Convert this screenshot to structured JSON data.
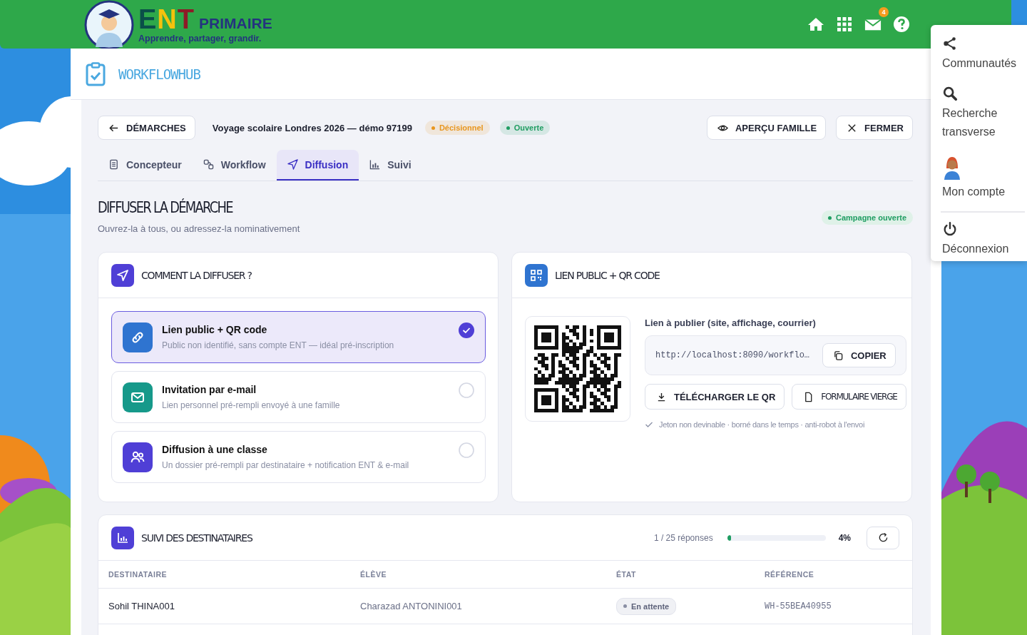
{
  "header": {
    "logo": {
      "letters": "ENT",
      "word": "PRIMAIRE",
      "tagline": "Apprendre, partager, grandir."
    },
    "mail_badge": "4"
  },
  "user_menu": [
    {
      "kind": "share",
      "label": "Communautés"
    },
    {
      "kind": "search",
      "label": "Recherche transverse"
    },
    {
      "kind": "avatar",
      "label": "Mon compte"
    },
    {
      "kind": "power",
      "label": "Déconnexion"
    }
  ],
  "app": {
    "title": "WORKFLOWHUB"
  },
  "toolbar": {
    "back_button": "DÉMARCHES",
    "title": "Voyage scolaire Londres 2026 — démo 97199",
    "badges": [
      {
        "label": "Décisionnel",
        "color": "#e8961e"
      },
      {
        "label": "Ouverte",
        "color": "#1f9d62"
      }
    ],
    "actions": [
      {
        "kind": "eye",
        "label": "APERÇU FAMILLE"
      },
      {
        "kind": "close",
        "label": "FERMER"
      }
    ]
  },
  "tabs": [
    {
      "label": "Concepteur",
      "selected": false
    },
    {
      "label": "Workflow",
      "selected": false
    },
    {
      "label": "Diffusion",
      "selected": true
    },
    {
      "label": "Suivi",
      "selected": false
    }
  ],
  "section": {
    "title": "DIFFUSER LA DÉMARCHE",
    "subtitle": "Ouvrez-la à tous, ou adressez-la nominativement",
    "status": "Campagne ouverte"
  },
  "how_card": {
    "title": "COMMENT LA DIFFUSER ?",
    "options": [
      {
        "color": "#2f74d0",
        "title": "Lien public + QR code",
        "description": "Public non identifié, sans compte ENT — idéal pré-inscription",
        "selected": true
      },
      {
        "color": "#16998a",
        "title": "Invitation par e-mail",
        "description": "Lien personnel pré-rempli envoyé à une famille",
        "selected": false
      },
      {
        "color": "#4f3fd6",
        "title": "Diffusion à une classe",
        "description": "Un dossier pré-rempli par destinataire + notification ENT & e-mail",
        "selected": false
      }
    ]
  },
  "link_card": {
    "title": "LIEN PUBLIC + QR CODE",
    "label": "Lien à publier (site, affichage, courrier)",
    "url": "http://localhost:8090/workflo…",
    "copy_button": "COPIER",
    "download_button": "TÉLÉCHARGER LE QR",
    "form_button": "FORMULAIRE VIERGE",
    "note": "Jeton non devinable · borné dans le temps · anti-robot à l'envoi"
  },
  "tracking": {
    "title": "SUIVI DES DESTINATAIRES",
    "count": "1 / 25 réponses",
    "level": 0.04,
    "percent": "4%",
    "columns": [
      "DESTINATAIRE",
      "ÉLÈVE",
      "ÉTAT",
      "RÉFÉRENCE"
    ],
    "rows": [
      {
        "recipient": "Sohil THINA001",
        "student": "Charazad ANTONINI001",
        "status": "En attente",
        "reference": "WH-55BEA40955"
      }
    ]
  }
}
